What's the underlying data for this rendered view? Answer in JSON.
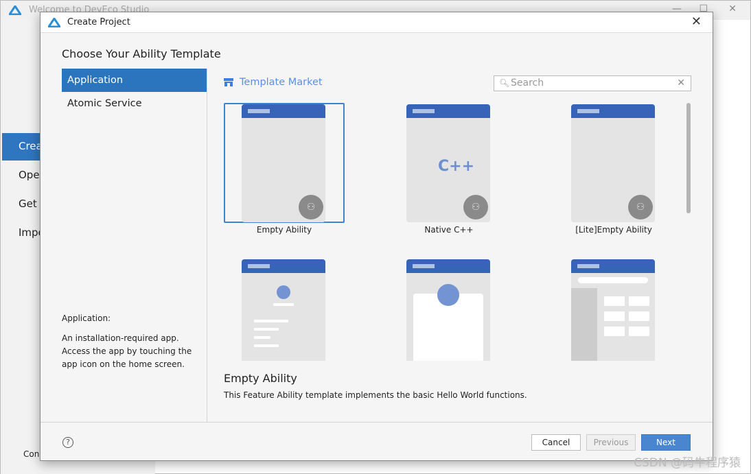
{
  "background_window": {
    "title": "Welcome to DevEco Studio",
    "sidebar_items": [
      "Crea",
      "Oper",
      "Get t",
      "Impo"
    ],
    "footer_fragment": "Con"
  },
  "dialog": {
    "title": "Create Project",
    "heading": "Choose Your Ability Template",
    "categories": [
      {
        "label": "Application",
        "selected": true
      },
      {
        "label": "Atomic Service",
        "selected": false
      }
    ],
    "category_description": {
      "title": "Application:",
      "text": "An installation-required app. Access the app by touching the app icon on the home screen."
    },
    "template_market": "Template Market",
    "search": {
      "placeholder": "Search",
      "value": ""
    },
    "templates": [
      {
        "label": "Empty Ability",
        "selected": true
      },
      {
        "label": "Native C++",
        "selected": false,
        "glyph": "C++"
      },
      {
        "label": "[Lite]Empty Ability",
        "selected": false
      },
      {
        "label": "",
        "selected": false
      },
      {
        "label": "",
        "selected": false
      },
      {
        "label": "",
        "selected": false
      }
    ],
    "selected_template": {
      "title": "Empty Ability",
      "description": "This Feature Ability template implements the basic Hello World functions."
    },
    "buttons": {
      "cancel": "Cancel",
      "previous": "Previous",
      "next": "Next"
    },
    "colors": {
      "accent": "#2a75bd",
      "header_bar": "#3763b8",
      "primary_button": "#4a86cf"
    }
  },
  "watermark": "CSDN @码牛程序猿"
}
